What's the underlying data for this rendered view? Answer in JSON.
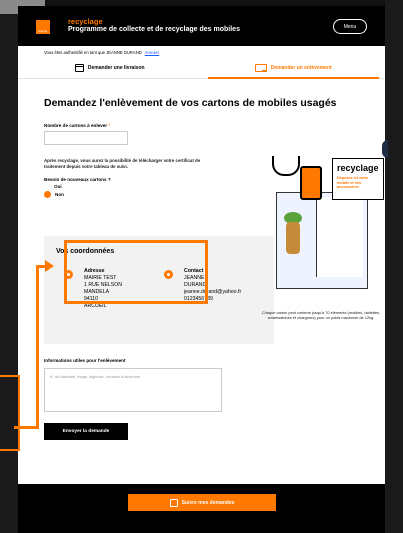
{
  "header": {
    "logo_text": "orange",
    "brand": "recyclage",
    "title": "Programme de collecte et de recyclage des mobiles",
    "menu_label": "Menu"
  },
  "auth": {
    "text": "Vous êtes authentifié en tant que JEANNE DURAND",
    "link": "Annuler"
  },
  "tabs": [
    {
      "label": "Demander une livraison",
      "icon": "box-icon"
    },
    {
      "label": "Demander un enlèvement",
      "icon": "truck-icon"
    }
  ],
  "main": {
    "heading": "Demandez l'enlèvement de vos cartons de mobiles usagés",
    "cartons_label": "Nombre de cartons à enlever",
    "required_mark": "*",
    "info_text": "Après recyclage, vous aurez la possibilité de télécharger votre certificat de traitement depuis votre tableau de suivi.",
    "new_boxes_question": "Besoin de nouveaux cartons ?",
    "option_yes": "Oui",
    "option_no": "Non"
  },
  "coords": {
    "title": "Vos coordonnées",
    "address_label": "Adresse",
    "address_lines": [
      "MAIRIE TEST",
      "1 RUE NELSON",
      "MANDELA",
      "94110",
      "ARCUEIL"
    ],
    "contact_label": "Contact",
    "contact_lines": [
      "JEANNE",
      "DURAND",
      "jeanne.durand@yahoo.fr",
      "0123456789"
    ]
  },
  "illustration": {
    "lid_brand": "recyclage",
    "lid_sub": "Déposez ici votre mobile et ses accessoires",
    "caption": "Chaque carton peut contenir jusqu'à 70 éléments (mobiles, tablettes, smartwatches et chargeurs) pour un poids maximum de 12kg."
  },
  "form": {
    "useful_label": "Informations utiles pour l'enlèvement",
    "useful_placeholder": "n° du bâtiment, étage, digicode, horaires d'ouverture",
    "submit_label": "Envoyer la demande"
  },
  "footer": {
    "follow_label": "Suivre mes demandes"
  },
  "colors": {
    "accent": "#ff7900",
    "dark": "#000000"
  }
}
